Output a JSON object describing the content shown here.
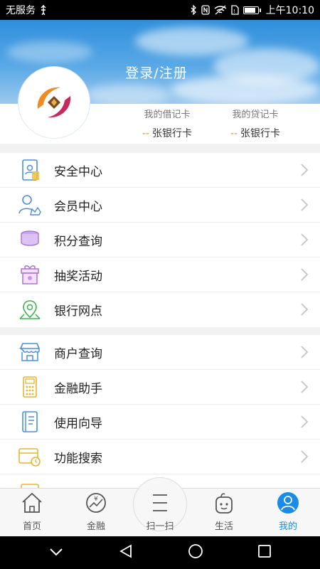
{
  "status_bar": {
    "carrier": "无服务",
    "time": "上午10:10"
  },
  "header": {
    "login_title": "登录/注册"
  },
  "cards": [
    {
      "label": "我的借记卡",
      "dash": "--",
      "unit": "张银行卡"
    },
    {
      "label": "我的贷记卡",
      "dash": "--",
      "unit": "张银行卡"
    }
  ],
  "menu_section_1": [
    {
      "label": "安全中心",
      "icon": "security-doc-icon"
    },
    {
      "label": "会员中心",
      "icon": "member-icon"
    },
    {
      "label": "积分查询",
      "icon": "points-coins-icon"
    },
    {
      "label": "抽奖活动",
      "icon": "gift-icon"
    },
    {
      "label": "银行网点",
      "icon": "map-pin-icon"
    }
  ],
  "menu_section_2": [
    {
      "label": "商户查询",
      "icon": "store-icon"
    },
    {
      "label": "金融助手",
      "icon": "calculator-icon"
    },
    {
      "label": "使用向导",
      "icon": "guide-book-icon"
    },
    {
      "label": "功能搜索",
      "icon": "function-search-icon"
    }
  ],
  "bottom_nav": [
    {
      "label": "首页",
      "icon": "home-icon"
    },
    {
      "label": "金融",
      "icon": "finance-icon"
    },
    {
      "label": "扫一扫",
      "icon": "scan-icon"
    },
    {
      "label": "生活",
      "icon": "life-icon"
    },
    {
      "label": "我的",
      "icon": "profile-icon",
      "active": true
    }
  ],
  "colors": {
    "accent": "#1a8ce8",
    "header_blue": "#2f8fdc",
    "dash_orange": "#f08a23"
  }
}
